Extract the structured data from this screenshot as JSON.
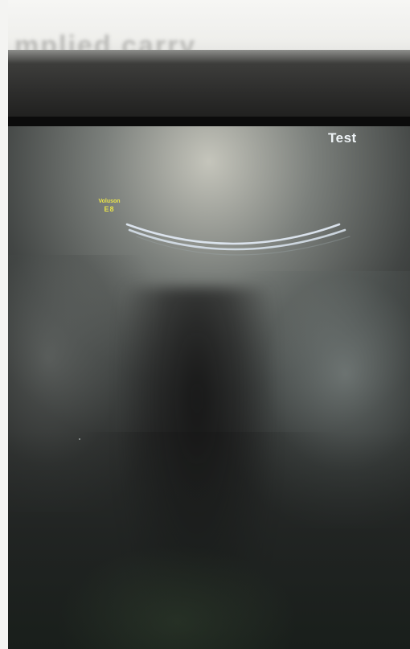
{
  "paper": {
    "text": "mplied carry"
  },
  "screen": {
    "title": "Test",
    "logo": {
      "line1": "Voluson",
      "line2": "E8"
    }
  },
  "colors": {
    "logo_yellow": "#e8e24a",
    "title_white": "#eef3f6",
    "arc_color": "#dfe8f2"
  }
}
